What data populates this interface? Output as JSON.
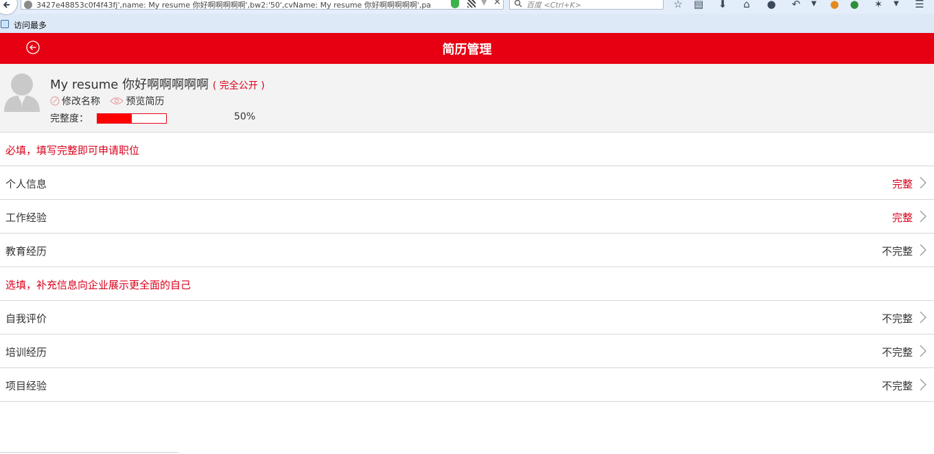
{
  "browser": {
    "url_text": "3427e48853c0f4f43fj',name: My resume 你好啊啊啊啊啊',bw2:'50',cvName: My resume 你好啊啊啊啊啊',pa",
    "search_placeholder": "百度 <Ctrl+K>",
    "bookmark_label": "访问最多"
  },
  "header": {
    "title": "简历管理"
  },
  "profile": {
    "resume_name": "My resume 你好啊啊啊啊啊",
    "visibility": "( 完全公开 )",
    "rename_label": "修改名称",
    "preview_label": "预览简历",
    "completeness_label": "完整度：",
    "completeness_percent": "50%",
    "completeness_fraction": 0.5
  },
  "required_section": {
    "heading": "必填，填写完整即可申请职位",
    "items": [
      {
        "label": "个人信息",
        "status": "完整"
      },
      {
        "label": "工作经验",
        "status": "完整"
      },
      {
        "label": "教育经历",
        "status": "不完整"
      }
    ]
  },
  "optional_section": {
    "heading": "选填，补充信息向企业展示更全面的自己",
    "items": [
      {
        "label": "自我评价",
        "status": "不完整"
      },
      {
        "label": "培训经历",
        "status": "不完整"
      },
      {
        "label": "项目经验",
        "status": "不完整"
      }
    ]
  },
  "colors": {
    "brand_red": "#e60012",
    "complete_red": "#d9001b"
  }
}
